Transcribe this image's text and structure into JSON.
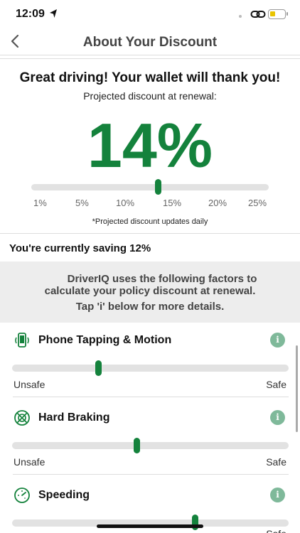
{
  "status_bar": {
    "time": "12:09",
    "icons": [
      "location-arrow-icon",
      "link-icon",
      "battery-icon"
    ],
    "battery_color": "#e9c400"
  },
  "nav": {
    "back_icon": "chevron-left-icon",
    "title": "About Your Discount"
  },
  "hero": {
    "headline": "Great driving! Your wallet will thank you!",
    "subtitle": "Projected discount at renewal:",
    "discount": "14%",
    "discount_value": 14,
    "scale_ticks": [
      "1%",
      "5%",
      "10%",
      "15%",
      "20%",
      "25%"
    ],
    "scale_min": 1,
    "scale_max": 25,
    "note": "*Projected discount updates daily"
  },
  "saving": {
    "text": "You're currently saving 12%"
  },
  "info": {
    "line1": "DriverIQ uses the following factors to",
    "line2": "calculate your policy discount at renewal.",
    "line3": "Tap 'i' below for more details."
  },
  "factors": [
    {
      "label": "Phone Tapping & Motion",
      "icon": "phone-motion-icon",
      "level": 0.31,
      "min_label": "Unsafe",
      "max_label": "Safe",
      "info_label": "i"
    },
    {
      "label": "Hard Braking",
      "icon": "hard-braking-icon",
      "level": 0.45,
      "min_label": "Unsafe",
      "max_label": "Safe",
      "info_label": "i"
    },
    {
      "label": "Speeding",
      "icon": "speedometer-icon",
      "level": 0.66,
      "min_label": "Unsafe",
      "max_label": "Safe",
      "info_label": "i"
    }
  ],
  "colors": {
    "accent_green": "#14823c",
    "info_badge": "#7fb99a",
    "track": "#e2e2e2"
  }
}
